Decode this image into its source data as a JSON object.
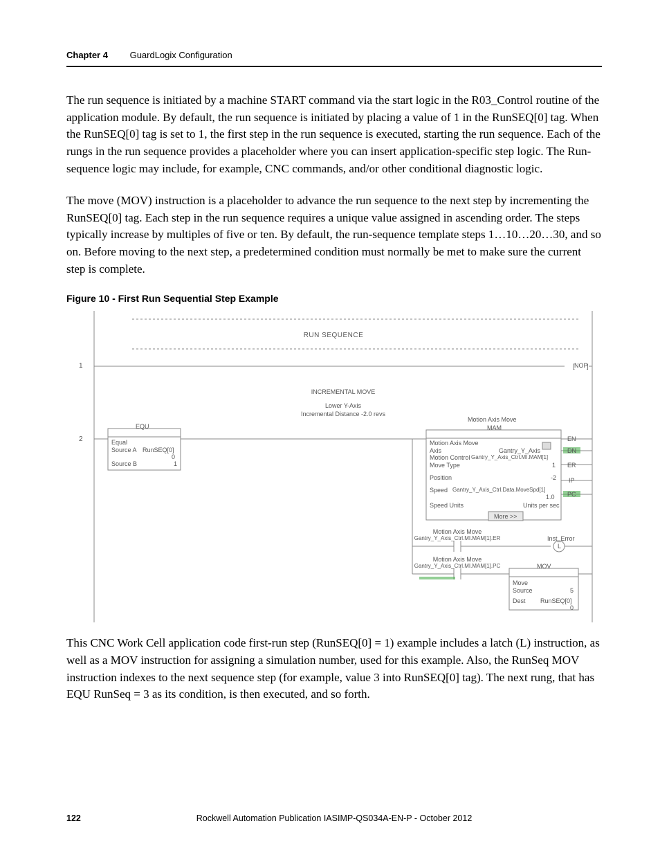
{
  "header": {
    "chapter": "Chapter 4",
    "title": "GuardLogix Configuration"
  },
  "para1": "The run sequence is initiated by a machine START command via the start logic in the R03_Control routine of the application module. By default, the run sequence is initiated by placing a value of 1 in the RunSEQ[0] tag. When the RunSEQ[0] tag is set to 1, the first step in the run sequence is executed, starting the run sequence. Each of the rungs in the run sequence provides a placeholder where you can insert application-specific step logic. The Run-sequence logic may include, for example, CNC commands, and/or other conditional diagnostic logic.",
  "para2": "The move (MOV) instruction is a placeholder to advance the run sequence to the next step by incrementing the RunSEQ[0] tag. Each step in the run sequence requires a unique value assigned in ascending order. The steps typically increase by multiples of five or ten. By default, the run-sequence template steps 1…10…20…30, and so on. Before moving to the next step, a predetermined condition must normally be met to make sure the current step is complete.",
  "figure_title": "Figure 10 - First Run Sequential Step Example",
  "fig": {
    "rung1_num": "1",
    "rung2_num": "2",
    "run_sequence": "RUN SEQUENCE",
    "nop": "NOP",
    "inc_move": "INCREMENTAL MOVE",
    "lower_y": "Lower Y-Axis",
    "inc_dist": "Incremental Distance -2.0 revs",
    "equ_title": "EQU",
    "equ_equal": "Equal",
    "equ_srcA_lbl": "Source A",
    "equ_srcA_val": "RunSEQ[0]",
    "equ_srcA_num": "0",
    "equ_srcB_lbl": "Source B",
    "equ_srcB_val": "1",
    "mam_top": "Motion Axis Move",
    "mam_title": "MAM",
    "mam_line1": "Motion Axis Move",
    "mam_axis_lbl": "Axis",
    "mam_axis_val": "Gantry_Y_Axis",
    "mam_mc_lbl": "Motion Control",
    "mam_mc_val": "Gantry_Y_Axis_Ctrl.MI.MAM[1]",
    "mam_mt_lbl": "Move Type",
    "mam_mt_val": "1",
    "mam_pos_lbl": "Position",
    "mam_pos_val": "-2",
    "mam_spd_lbl": "Speed",
    "mam_spd_val": "Gantry_Y_Axis_Ctrl.Data.MoveSpd[1]",
    "mam_spd_num": "1.0",
    "mam_su_lbl": "Speed Units",
    "mam_su_val": "Units per sec",
    "mam_more": "More >>",
    "en": "EN",
    "dn": "DN",
    "er": "ER",
    "ip": "IP",
    "pc": "PC",
    "branch2_top": "Motion Axis Move",
    "branch2_tag": "Gantry_Y_Axis_Ctrl.MI.MAM[1].ER",
    "inst_error": "Inst_Error",
    "latch": "L",
    "branch3_top": "Motion Axis Move",
    "branch3_tag": "Gantry_Y_Axis_Ctrl.MI.MAM[1].PC",
    "mov_title": "MOV",
    "mov_move": "Move",
    "mov_src_lbl": "Source",
    "mov_src_val": "5",
    "mov_dst_lbl": "Dest",
    "mov_dst_val": "RunSEQ[0]",
    "mov_dst_num": "0"
  },
  "para3": "This CNC Work Cell application code first-run step (RunSEQ[0] = 1) example includes a latch (L) instruction, as well as a MOV instruction for assigning a simulation number, used for this example. Also, the RunSeq MOV instruction indexes to the next sequence step (for example, value 3 into RunSEQ[0] tag). The next rung, that has EQU RunSeq = 3 as its condition, is then executed, and so forth.",
  "footer": {
    "page": "122",
    "pub_prefix": "Rockwell Automation Publication IASIMP-QS034A-EN-P - ",
    "pub_date": "October 2012"
  }
}
